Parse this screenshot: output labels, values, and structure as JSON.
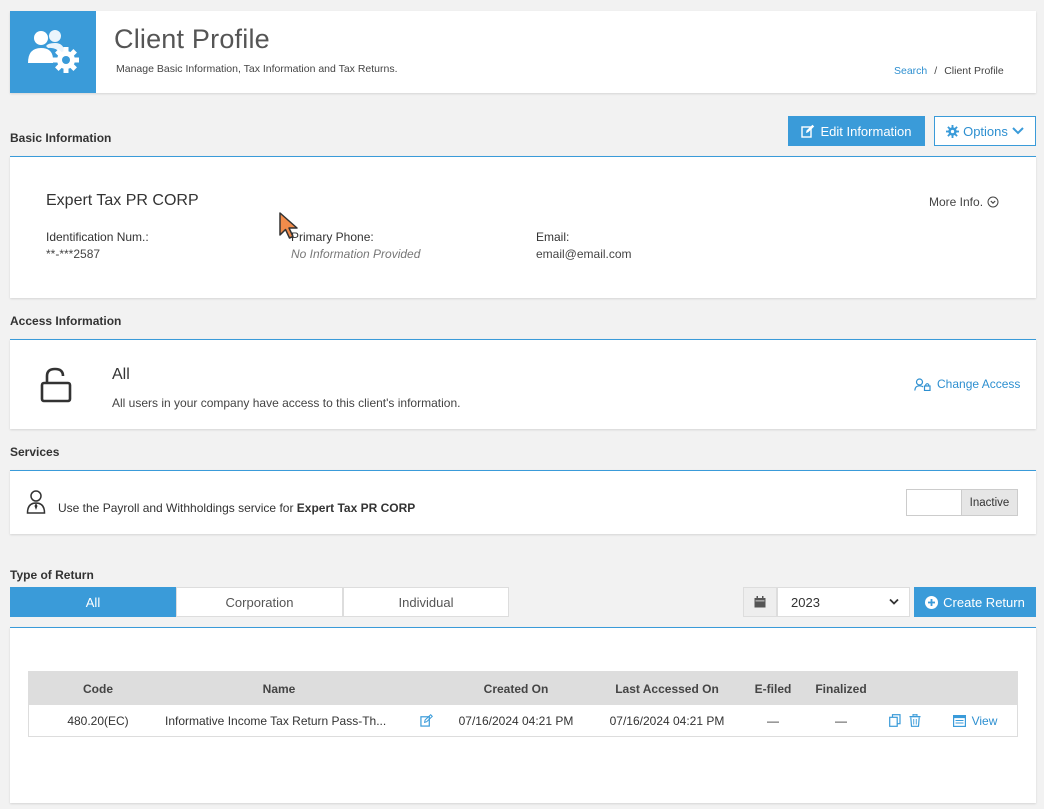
{
  "header": {
    "title": "Client Profile",
    "subtitle": "Manage Basic Information, Tax Information and Tax Returns.",
    "breadcrumb": {
      "link": "Search",
      "separator": "/",
      "current": "Client Profile"
    }
  },
  "basic_info": {
    "section_title": "Basic Information",
    "edit_label": "Edit Information",
    "options_label": "Options",
    "client_name": "Expert Tax PR CORP",
    "more_info": "More Info.",
    "id_label": "Identification Num.:",
    "id_value": "**-***2587",
    "phone_label": "Primary Phone:",
    "phone_value": "No Information Provided",
    "email_label": "Email:",
    "email_value": "email@email.com"
  },
  "access": {
    "section_title": "Access Information",
    "level": "All",
    "description": "All users in your company have access to this client's information.",
    "change_label": "Change Access"
  },
  "services": {
    "section_title": "Services",
    "text_prefix": "Use the Payroll and Withholdings service for",
    "client_name": "Expert Tax PR CORP",
    "toggle_state": "Inactive"
  },
  "returns": {
    "section_title": "Type of Return",
    "tabs": [
      {
        "label": "All",
        "active": true
      },
      {
        "label": "Corporation",
        "active": false
      },
      {
        "label": "Individual",
        "active": false
      }
    ],
    "year": "2023",
    "create_label": "Create Return",
    "columns": [
      "Code",
      "Name",
      "Created On",
      "Last Accessed On",
      "E-filed",
      "Finalized"
    ],
    "rows": [
      {
        "code": "480.20(EC)",
        "name": "Informative Income Tax Return Pass-Th...",
        "created_on": "07/16/2024 04:21 PM",
        "last_accessed": "07/16/2024 04:21 PM",
        "efiled": "—",
        "finalized": "—",
        "view_label": "View"
      }
    ]
  },
  "colors": {
    "accent": "#3a9bd9",
    "link": "#2d8fd0",
    "header_bg": "#dddddd"
  }
}
